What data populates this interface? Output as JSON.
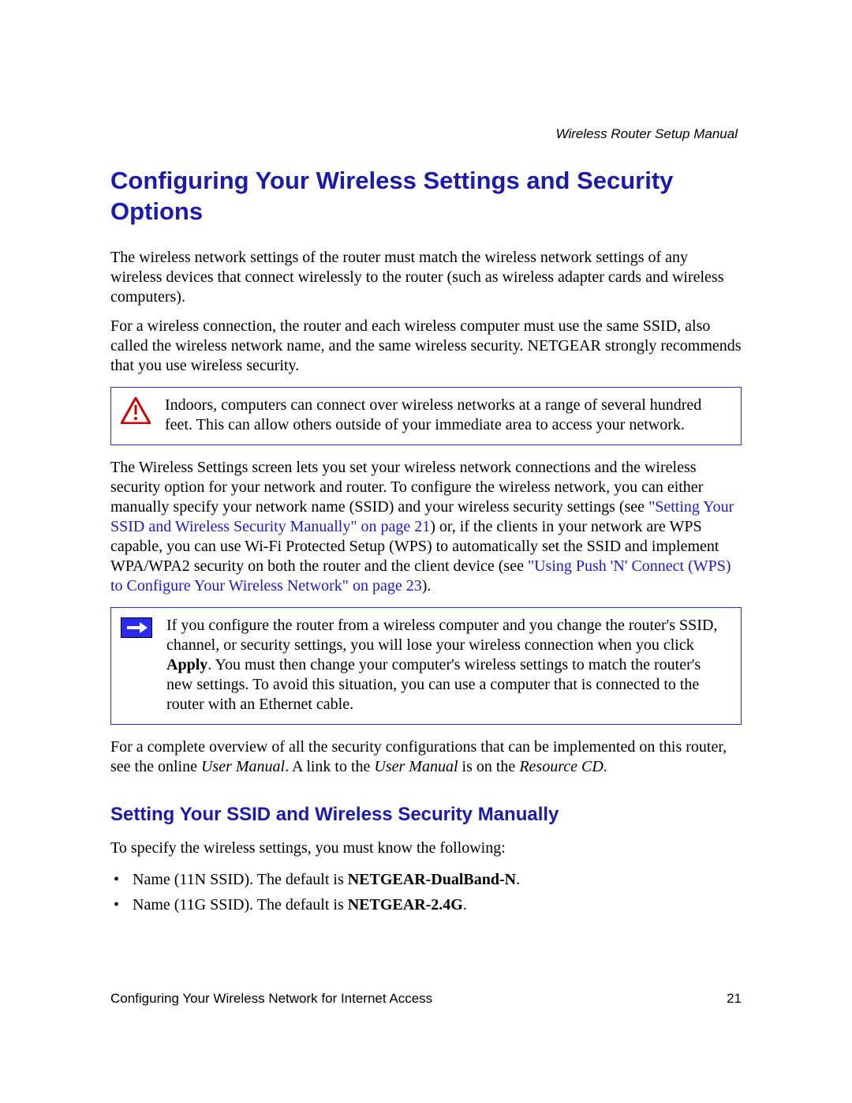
{
  "header": {
    "running_title": "Wireless Router Setup Manual"
  },
  "title": "Configuring Your Wireless Settings and Security Options",
  "para1": "The wireless network settings of the router must match the wireless network settings of any wireless devices that connect wirelessly to the router (such as wireless adapter cards and wireless computers).",
  "para2": "For a wireless connection, the router and each wireless computer must use the same SSID, also called the wireless network name, and the same wireless security. NETGEAR strongly recommends that you use wireless security.",
  "warning_callout": "Indoors, computers can connect over wireless networks at a range of several hundred feet. This can allow others outside of your immediate area to access your network.",
  "para3_a": "The Wireless Settings screen lets you set your wireless network connections and the wireless security option for your network and router. To configure the wireless network, you can either manually specify your network name (SSID) and your wireless security settings (see ",
  "para3_link1": "\"Setting Your SSID and Wireless Security Manually\" on page 21",
  "para3_b": ") or, if the clients in your network are WPS capable, you can use Wi-Fi Protected Setup (WPS) to automatically set the SSID and implement WPA/WPA2 security on both the router and the client device (see ",
  "para3_link2": "\"Using Push 'N' Connect (WPS) to Configure Your Wireless Network\" on page 23",
  "para3_c": ").",
  "note_callout_a": "If you configure the router from a wireless computer and you change the router's SSID, channel, or security settings, you will lose your wireless connection when you click ",
  "note_callout_bold": "Apply",
  "note_callout_b": ". You must then change your computer's wireless settings to match the router's new settings. To avoid this situation, you can use a computer that is connected to the router with an Ethernet cable.",
  "para4_a": "For a complete overview of all the security configurations that can be implemented on this router, see the online ",
  "para4_i1": "User Manual",
  "para4_b": ". A link to the ",
  "para4_i2": "User Manual",
  "para4_c": " is on the ",
  "para4_i3": "Resource CD",
  "para4_d": ".",
  "subtitle": "Setting Your SSID and Wireless Security Manually",
  "para5": "To specify the wireless settings, you must know the following:",
  "bullets": {
    "b1_a": "Name (11N SSID). The default is ",
    "b1_bold": "NETGEAR-DualBand-N",
    "b1_b": ".",
    "b2_a": "Name (11G SSID). The default is ",
    "b2_bold": "NETGEAR-2.4G",
    "b2_b": "."
  },
  "footer": {
    "chapter": "Configuring Your Wireless Network for Internet Access",
    "page": "21"
  }
}
